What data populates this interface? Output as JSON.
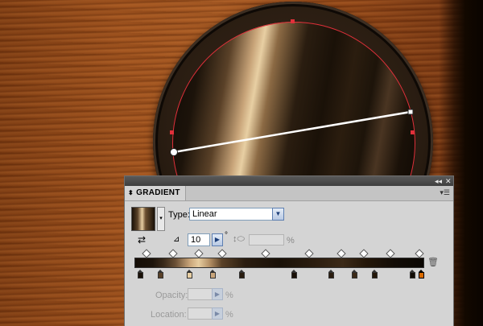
{
  "panel": {
    "title": "GRADIENT",
    "type_label": "Type:",
    "type_value": "Linear",
    "angle_value": "10",
    "degree_sign": "°",
    "aspect_ratio_value": "",
    "percent": "%",
    "opacity_label": "Opacity:",
    "opacity_value": "",
    "location_label": "Location:",
    "location_value": "",
    "collapse_glyph": "◂◂",
    "close_glyph": "✕",
    "tab_arrow_glyph": "⬍",
    "menu_glyph": "▾☰"
  },
  "icons": {
    "dropdown_arrow": "▼",
    "spin_right": "▶",
    "angle": "⊿",
    "reverse": "⇄",
    "aspect": "↕⬭",
    "trash": "🗑",
    "swatch_menu": "▾"
  },
  "gradient_stops": {
    "colors": [
      "#1a1108",
      "#5a4128",
      "#e8cfa3",
      "#c9a57a",
      "#2a1d10",
      "#1a1108",
      "#2b1d0f",
      "#3c2a18",
      "#241709",
      "#120c06",
      "#d96a00"
    ],
    "positions_pct": [
      2,
      9,
      19,
      27,
      37,
      55,
      68,
      76,
      83,
      96,
      99
    ],
    "midpoints_pct": [
      4,
      13,
      22,
      30,
      45,
      60,
      71,
      79,
      88,
      98
    ],
    "selected_index": 10
  },
  "colors": {
    "selection_red": "#e0303a",
    "panel_bg": "#d4d4d4",
    "accent_orange": "#d96a00"
  }
}
